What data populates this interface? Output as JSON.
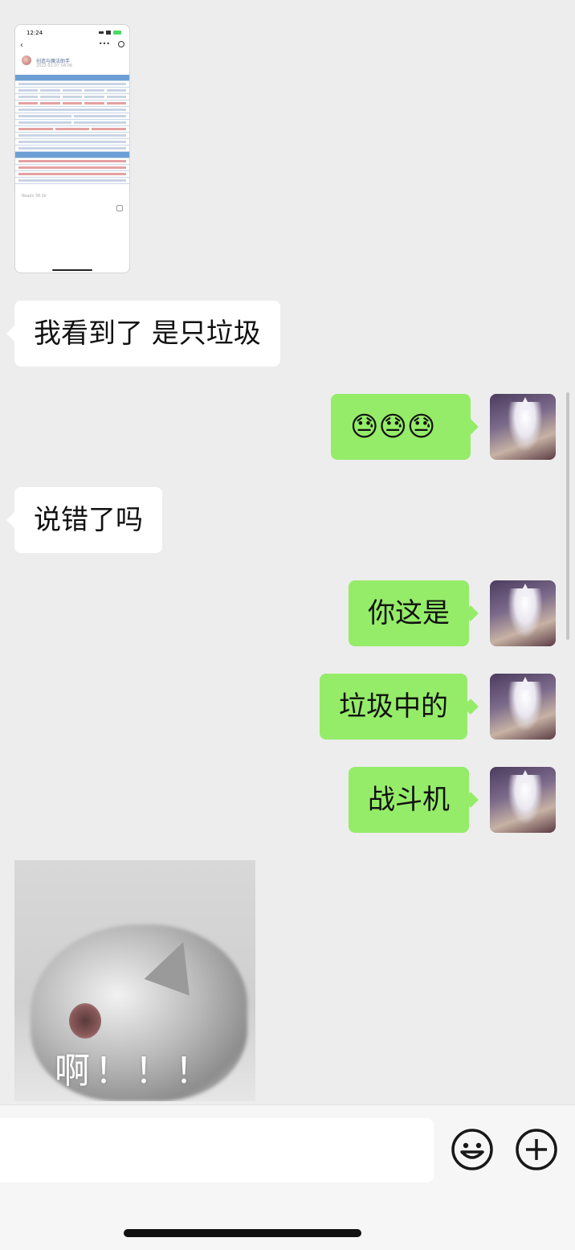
{
  "shared_screenshot": {
    "status_time": "12:24",
    "account_name": "创造与魔法助手",
    "date": "2022-01-07 04:06",
    "reads": "Reads 36.1k"
  },
  "messages": [
    {
      "side": "left",
      "text": "我看到了 是只垃圾"
    },
    {
      "side": "right",
      "text": "😓😓😓"
    },
    {
      "side": "left",
      "text": "说错了吗"
    },
    {
      "side": "right",
      "text": "你这是"
    },
    {
      "side": "right",
      "text": "垃圾中的"
    },
    {
      "side": "right",
      "text": "战斗机"
    }
  ],
  "sticker": {
    "text": "啊！！！"
  },
  "input_bar": {
    "input_value": "",
    "emoji_icon": "emoji-face-icon",
    "more_icon": "plus-circle-icon"
  },
  "colors": {
    "background": "#ededed",
    "self_bubble": "#95ec69",
    "other_bubble": "#ffffff"
  }
}
